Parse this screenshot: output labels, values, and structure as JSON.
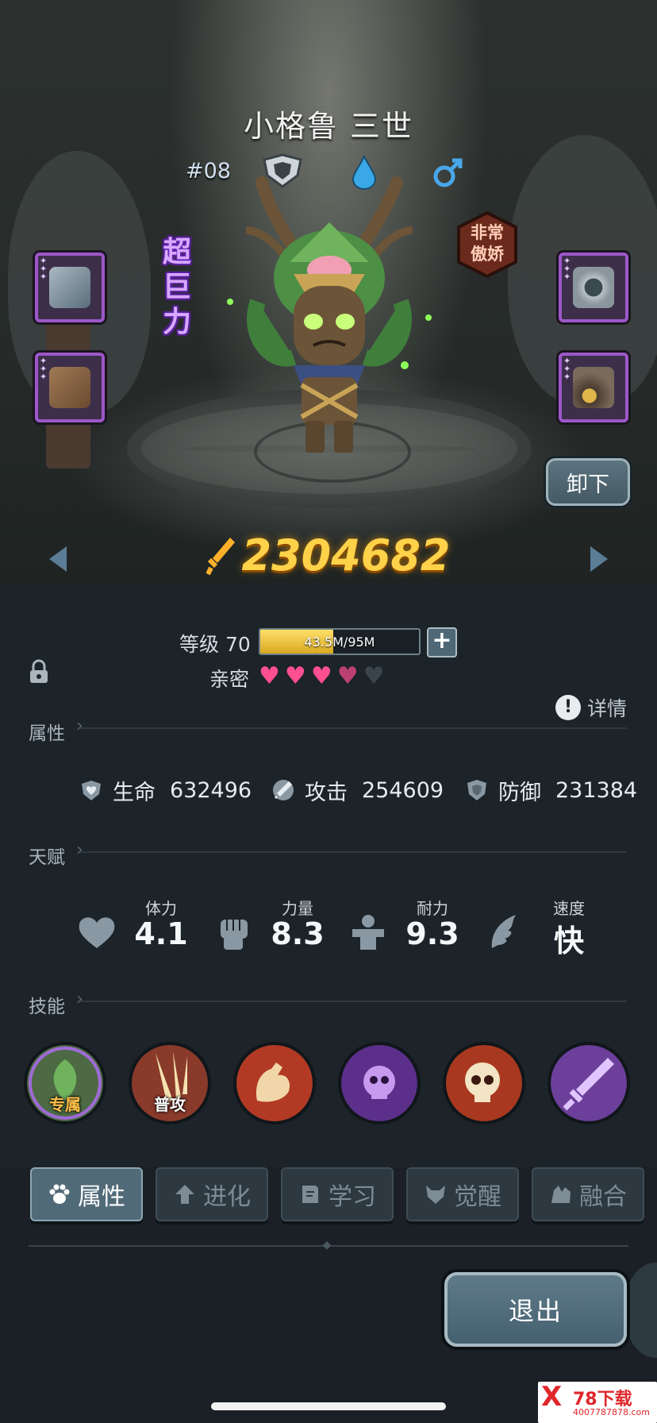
{
  "hero": {
    "name": "小格鲁 三世",
    "id": "#08",
    "trait_chars": [
      "超",
      "巨",
      "力"
    ],
    "mood": "非常\n傲娇",
    "power": "2304682"
  },
  "controls": {
    "unequip_label": "卸下",
    "exit_label": "退出"
  },
  "progress": {
    "level_label": "等级 70",
    "level_text": "43.5M/95M",
    "level_fraction": 0.458,
    "intimacy_label": "亲密",
    "hearts_filled": 3,
    "hearts_half": 1,
    "hearts_total": 5
  },
  "detail_label": "详情",
  "sections": {
    "attributes": "属性",
    "talents": "天赋",
    "skills": "技能"
  },
  "attributes": [
    {
      "label": "生命",
      "value": "632496",
      "icon": "heart-shield-icon"
    },
    {
      "label": "攻击",
      "value": "254609",
      "icon": "sword-icon"
    },
    {
      "label": "防御",
      "value": "231384",
      "icon": "shield-icon"
    }
  ],
  "talents": [
    {
      "label": "体力",
      "value": "4.1",
      "icon": "heart-icon"
    },
    {
      "label": "力量",
      "value": "8.3",
      "icon": "fist-icon"
    },
    {
      "label": "耐力",
      "value": "9.3",
      "icon": "muscle-icon"
    },
    {
      "label": "速度",
      "value": "快",
      "icon": "wing-icon"
    }
  ],
  "skills": [
    {
      "label": "专属",
      "color": "#4d6a44"
    },
    {
      "label": "普攻",
      "color": "#8a3a2a"
    },
    {
      "label": "",
      "color": "#b23a24"
    },
    {
      "label": "",
      "color": "#5b2f8a"
    },
    {
      "label": "",
      "color": "#a8381f"
    },
    {
      "label": "",
      "color": "#6b3f9a"
    }
  ],
  "tabs": [
    {
      "label": "属性",
      "active": true
    },
    {
      "label": "进化",
      "active": false
    },
    {
      "label": "学习",
      "active": false
    },
    {
      "label": "觉醒",
      "active": false
    },
    {
      "label": "融合",
      "active": false
    }
  ],
  "watermark": {
    "logo": "X",
    "brand": "78下载",
    "site": "4007787878.com"
  },
  "colors": {
    "accent_gold": "#ffd24a",
    "equip_border": "#9c57c9",
    "heart": "#ff4f8e"
  }
}
